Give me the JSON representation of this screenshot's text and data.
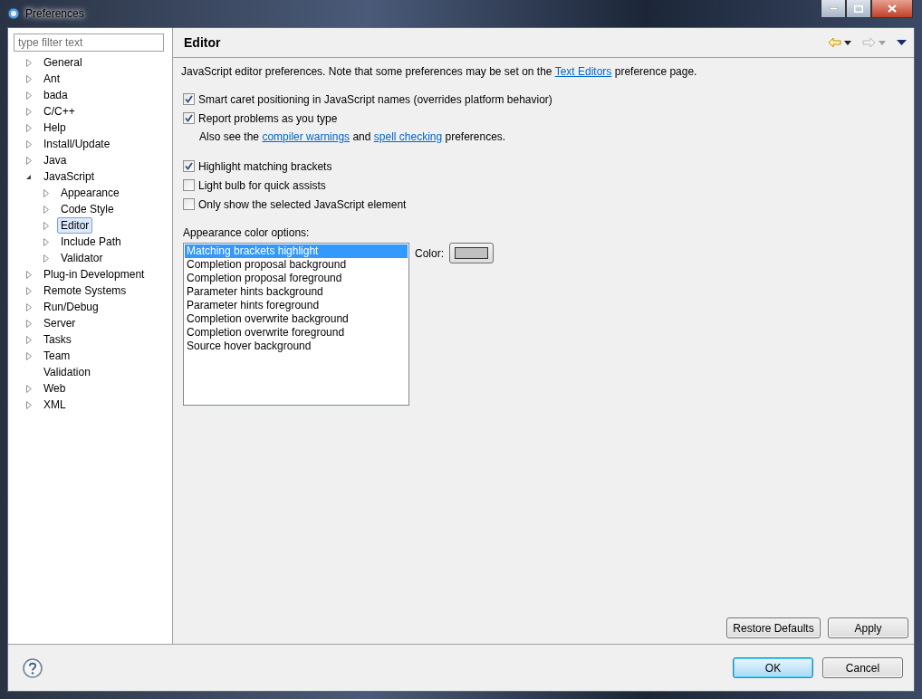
{
  "window": {
    "title": "Preferences"
  },
  "filter": {
    "placeholder": "type filter text"
  },
  "tree": [
    {
      "label": "General",
      "expandable": true,
      "expanded": false,
      "selected": false
    },
    {
      "label": "Ant",
      "expandable": true,
      "expanded": false,
      "selected": false
    },
    {
      "label": "bada",
      "expandable": true,
      "expanded": false,
      "selected": false
    },
    {
      "label": "C/C++",
      "expandable": true,
      "expanded": false,
      "selected": false
    },
    {
      "label": "Help",
      "expandable": true,
      "expanded": false,
      "selected": false
    },
    {
      "label": "Install/Update",
      "expandable": true,
      "expanded": false,
      "selected": false
    },
    {
      "label": "Java",
      "expandable": true,
      "expanded": false,
      "selected": false
    },
    {
      "label": "JavaScript",
      "expandable": true,
      "expanded": true,
      "selected": false,
      "children": [
        {
          "label": "Appearance",
          "expandable": true,
          "expanded": false,
          "selected": false
        },
        {
          "label": "Code Style",
          "expandable": true,
          "expanded": false,
          "selected": false
        },
        {
          "label": "Editor",
          "expandable": true,
          "expanded": false,
          "selected": true
        },
        {
          "label": "Include Path",
          "expandable": true,
          "expanded": false,
          "selected": false
        },
        {
          "label": "Validator",
          "expandable": true,
          "expanded": false,
          "selected": false
        }
      ]
    },
    {
      "label": "Plug-in Development",
      "expandable": true,
      "expanded": false,
      "selected": false
    },
    {
      "label": "Remote Systems",
      "expandable": true,
      "expanded": false,
      "selected": false
    },
    {
      "label": "Run/Debug",
      "expandable": true,
      "expanded": false,
      "selected": false
    },
    {
      "label": "Server",
      "expandable": true,
      "expanded": false,
      "selected": false
    },
    {
      "label": "Tasks",
      "expandable": true,
      "expanded": false,
      "selected": false
    },
    {
      "label": "Team",
      "expandable": true,
      "expanded": false,
      "selected": false
    },
    {
      "label": "Validation",
      "expandable": false,
      "selected": false
    },
    {
      "label": "Web",
      "expandable": true,
      "expanded": false,
      "selected": false
    },
    {
      "label": "XML",
      "expandable": true,
      "expanded": false,
      "selected": false
    }
  ],
  "page": {
    "title": "Editor",
    "nav": {
      "back_disabled": false,
      "forward_disabled": true
    },
    "intro": [
      {
        "kind": "text",
        "text": "JavaScript editor preferences. Note that some preferences may be set on the "
      },
      {
        "kind": "link",
        "text": "Text Editors"
      },
      {
        "kind": "text",
        "text": " preference page."
      }
    ],
    "options": [
      {
        "kind": "checkbox",
        "label": "Smart caret positioning in JavaScript names (overrides platform behavior)",
        "checked": true
      },
      {
        "kind": "checkbox",
        "label": "Report problems as you type",
        "checked": true
      },
      {
        "kind": "note",
        "segments": [
          {
            "kind": "text",
            "text": "Also see the "
          },
          {
            "kind": "link",
            "text": "compiler warnings"
          },
          {
            "kind": "text",
            "text": " and "
          },
          {
            "kind": "link",
            "text": "spell checking"
          },
          {
            "kind": "text",
            "text": " preferences."
          }
        ]
      },
      {
        "kind": "gap"
      },
      {
        "kind": "checkbox",
        "label": "Highlight matching brackets",
        "checked": true
      },
      {
        "kind": "checkbox",
        "label": "Light bulb for quick assists",
        "checked": false
      },
      {
        "kind": "checkbox",
        "label": "Only show the selected JavaScript element",
        "checked": false
      }
    ],
    "color_options": {
      "label": "Appearance color options:",
      "color_label": "Color:",
      "items": [
        {
          "label": "Matching brackets highlight",
          "selected": true
        },
        {
          "label": "Completion proposal background",
          "selected": false
        },
        {
          "label": "Completion proposal foreground",
          "selected": false
        },
        {
          "label": "Parameter hints background",
          "selected": false
        },
        {
          "label": "Parameter hints foreground",
          "selected": false
        },
        {
          "label": "Completion overwrite background",
          "selected": false
        },
        {
          "label": "Completion overwrite foreground",
          "selected": false
        },
        {
          "label": "Source hover background",
          "selected": false
        }
      ]
    },
    "buttons": [
      "Restore Defaults",
      "Apply"
    ]
  },
  "dialog_buttons": [
    {
      "label": "OK",
      "default": true
    },
    {
      "label": "Cancel",
      "default": false
    }
  ]
}
